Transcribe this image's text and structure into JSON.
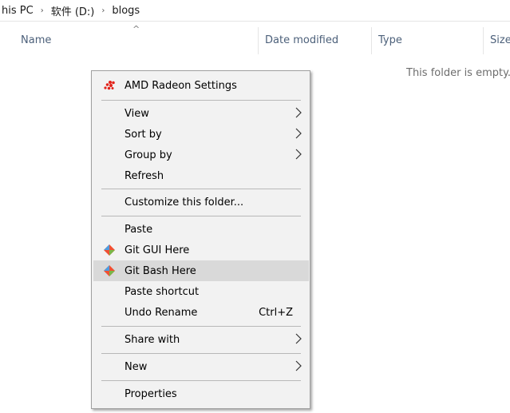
{
  "breadcrumb": {
    "items": [
      "his PC",
      "软件 (D:)",
      "blogs"
    ],
    "sep": "›"
  },
  "columns": {
    "name": "Name",
    "date_modified": "Date modified",
    "type": "Type",
    "size": "Size",
    "sort_indicator": "^"
  },
  "empty_message": "This folder is empty.",
  "context_menu": {
    "amd": "AMD Radeon Settings",
    "view": "View",
    "sort_by": "Sort by",
    "group_by": "Group by",
    "refresh": "Refresh",
    "customize": "Customize this folder...",
    "paste": "Paste",
    "git_gui": "Git GUI Here",
    "git_bash": "Git Bash Here",
    "paste_shortcut": "Paste shortcut",
    "undo_rename": "Undo Rename",
    "undo_shortcut": "Ctrl+Z",
    "share_with": "Share with",
    "new": "New",
    "properties": "Properties",
    "hovered_item": "Git Bash Here"
  },
  "colors": {
    "amd_red": "#e2231a",
    "git_orange": "#f05033",
    "git_blue": "#4f9de0",
    "header_text": "#4c607a",
    "hover_bg": "#d9d9d9"
  }
}
